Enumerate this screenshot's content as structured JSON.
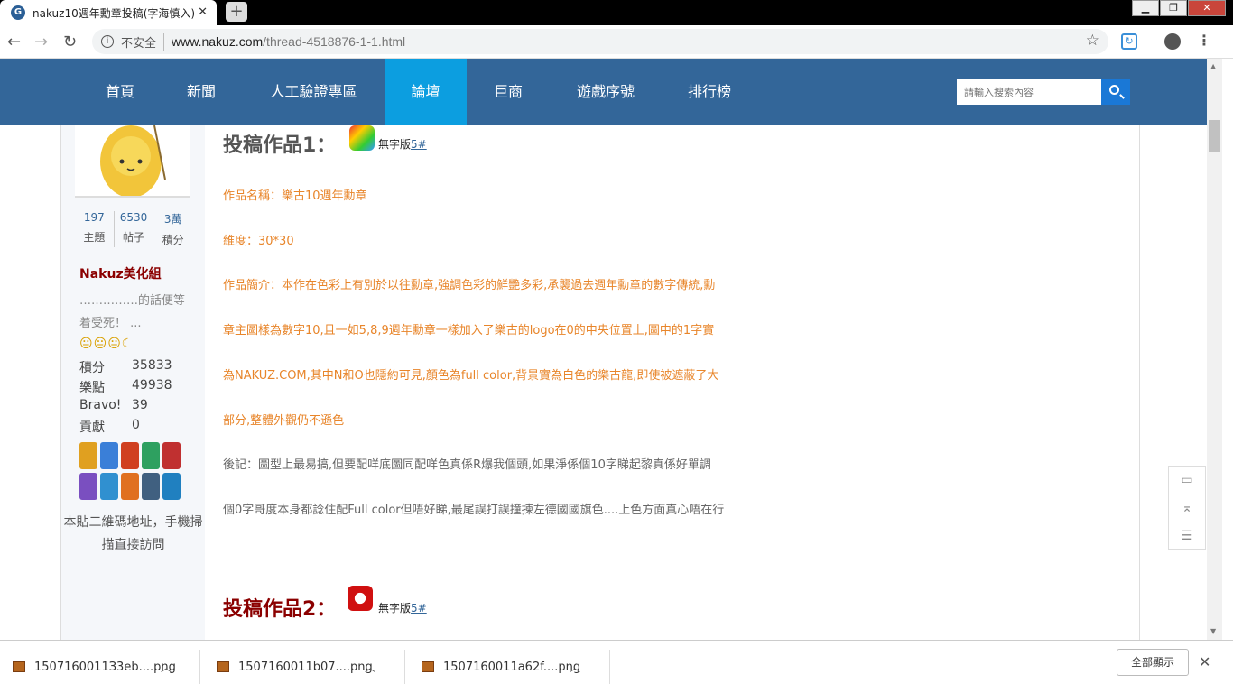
{
  "browser": {
    "tab_title": "nakuz10週年勳章投稿(字海慎入)",
    "tab_close": "✕",
    "new_tab": "+",
    "insecure_label": "不安全",
    "url_host": "www.nakuz.com",
    "url_path": "/thread-4518876-1-1.html"
  },
  "nav": {
    "items": [
      "首頁",
      "新聞",
      "人工驗證專區",
      "論壇",
      "巨商",
      "遊戲序號",
      "排行榜"
    ],
    "active": "論壇",
    "search_placeholder": "請輸入搜索內容"
  },
  "sidebar": {
    "stats": [
      {
        "num": "197",
        "label": "主題"
      },
      {
        "num": "6530",
        "label": "帖子"
      },
      {
        "num": "3萬",
        "label": "積分"
      }
    ],
    "group": "Nakuz美化組",
    "signature": "……………的話便等着受死！ ...",
    "faces": "😐😐😐☾",
    "info": [
      {
        "k": "積分",
        "v": "35833"
      },
      {
        "k": "樂點",
        "v": "49938"
      },
      {
        "k": "Bravo!",
        "v": "39"
      },
      {
        "k": "貢獻",
        "v": "0"
      }
    ],
    "medal_colors": [
      "#e0a020",
      "#3a7fd8",
      "#d04020",
      "#2ea060",
      "#c03030",
      "#7a4fc0",
      "#3090d0",
      "#e07020",
      "#406080",
      "#2080c0"
    ],
    "qr_alt": "本貼二維碼地址，手機掃描直接訪問"
  },
  "post": {
    "entry1_title": "投稿作品1：",
    "entry2_title": "投稿作品2：",
    "nolabel_text": "無字版",
    "nolabel_link": "5#",
    "lines": [
      {
        "text": "作品名稱：樂古10週年勳章",
        "color": "orange"
      },
      {
        "text": "維度：30*30",
        "color": "orange"
      },
      {
        "text": "作品簡介：本作在色彩上有別於以往勳章,強調色彩的鮮艷多彩,承襲過去週年勳章的數字傳統,勳",
        "color": "orange"
      },
      {
        "text": "章主圖樣為數字10,且一如5,8,9週年勳章一樣加入了樂古的logo在0的中央位置上,圖中的1字實",
        "color": "orange"
      },
      {
        "text": "為NAKUZ.COM,其中N和O也隱約可見,顏色為full color,背景實為白色的樂古龍,即使被遮蔽了大",
        "color": "orange"
      },
      {
        "text": "部分,整體外觀仍不遜色",
        "color": "orange"
      },
      {
        "text": "後記：圖型上最易搞,但要配咩底圖同配咩色真係R爆我個頭,如果淨係個10字睇起黎真係好單調",
        "color": "gray"
      },
      {
        "text": "個0字哥度本身都諗住配Full color但唔好睇,最尾誤打誤撞揀左德國國旗色....上色方面真心唔在行",
        "color": "gray"
      }
    ]
  },
  "downloads": {
    "items": [
      "1507160011З3eb....png",
      "1507160011b07....png",
      "1507160011a62f....png"
    ],
    "show_all": "全部顯示"
  }
}
